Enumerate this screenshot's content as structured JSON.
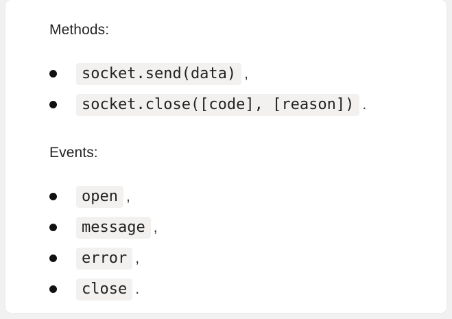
{
  "methods": {
    "heading": "Methods:",
    "items": [
      {
        "code": "socket.send(data)",
        "punct": ","
      },
      {
        "code": "socket.close([code], [reason])",
        "punct": "."
      }
    ]
  },
  "events": {
    "heading": "Events:",
    "items": [
      {
        "code": "open",
        "punct": ","
      },
      {
        "code": "message",
        "punct": ","
      },
      {
        "code": "error",
        "punct": ","
      },
      {
        "code": "close",
        "punct": "."
      }
    ]
  }
}
